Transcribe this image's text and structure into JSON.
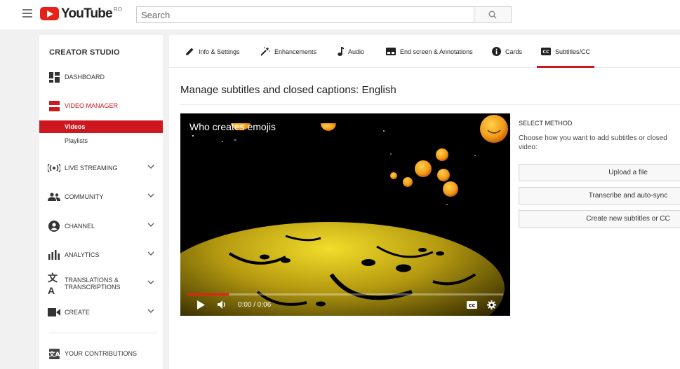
{
  "header": {
    "logo_text": "YouTube",
    "country": "RO",
    "search_placeholder": "Search"
  },
  "sidebar": {
    "title": "CREATOR STUDIO",
    "items": [
      {
        "label": "DASHBOARD",
        "icon": "dashboard-icon"
      },
      {
        "label": "VIDEO MANAGER",
        "icon": "video-manager-icon"
      },
      {
        "label": "LIVE STREAMING",
        "icon": "live-streaming-icon"
      },
      {
        "label": "COMMUNITY",
        "icon": "community-icon"
      },
      {
        "label": "CHANNEL",
        "icon": "channel-icon"
      },
      {
        "label": "ANALYTICS",
        "icon": "analytics-icon"
      },
      {
        "label": "TRANSLATIONS & TRANSCRIPTIONS",
        "icon": "translate-icon"
      },
      {
        "label": "CREATE",
        "icon": "create-icon"
      },
      {
        "label": "YOUR CONTRIBUTIONS",
        "icon": "contributions-icon"
      }
    ],
    "subitems": [
      {
        "label": "Videos",
        "active": true
      },
      {
        "label": "Playlists",
        "active": false
      }
    ]
  },
  "tabs": [
    {
      "label": "Info & Settings",
      "icon": "pencil-icon"
    },
    {
      "label": "Enhancements",
      "icon": "magic-wand-icon"
    },
    {
      "label": "Audio",
      "icon": "music-note-icon"
    },
    {
      "label": "End screen & Annotations",
      "icon": "end-screen-icon"
    },
    {
      "label": "Cards",
      "icon": "info-icon"
    },
    {
      "label": "Subtitles/CC",
      "icon": "cc-icon"
    }
  ],
  "active_tab": "Subtitles/CC",
  "page": {
    "title": "Manage subtitles and closed captions: English"
  },
  "video": {
    "title": "Who creates emojis",
    "time": "0:00 / 0:06",
    "progress_fraction": 0.13
  },
  "method": {
    "title": "SELECT METHOD",
    "description": "Choose how you want to add subtitles or closed video:",
    "buttons": [
      "Upload a file",
      "Transcribe and auto-sync",
      "Create new subtitles or CC"
    ]
  },
  "colors": {
    "brand_red": "#cc181e",
    "youtube_red": "#e62117",
    "smiley_yellow": "#f5a623"
  }
}
